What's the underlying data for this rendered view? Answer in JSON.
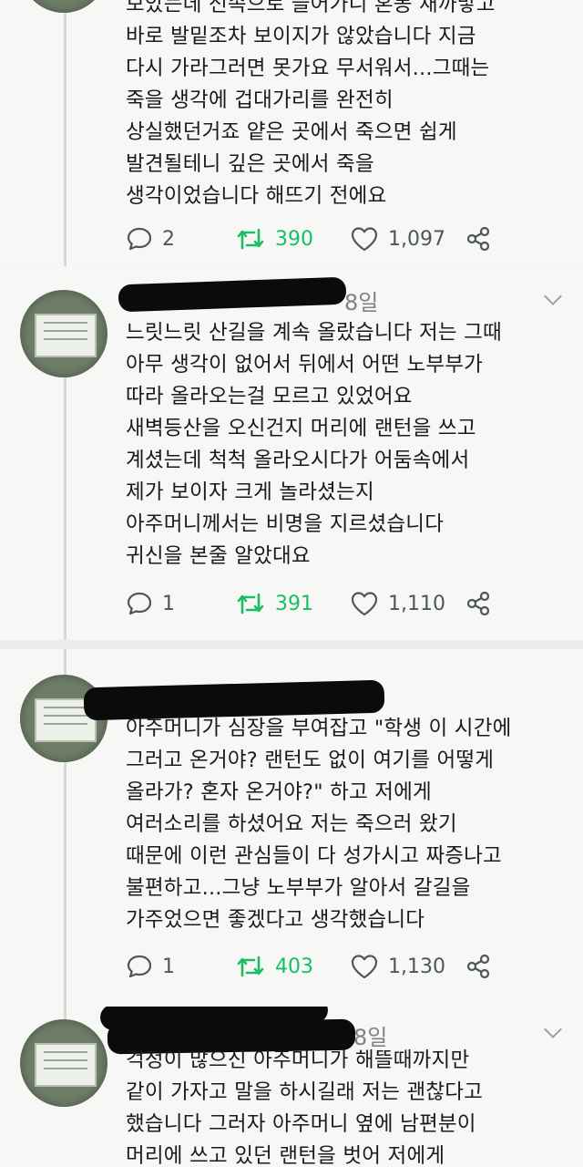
{
  "tweets": [
    {
      "lines": [
        "보았는데 전속으로 들어가니 혼동 새까맣고",
        "바로 발밑조차 보이지가 않았습니다 지금",
        "다시 가라그러면 못가요 무서워서...그때는",
        "죽을 생각에 겁대가리를 완전히",
        "상실했던거죠 얕은 곳에서 죽으면 쉽게",
        "발견될테니 깊은 곳에서 죽을",
        "생각이었습니다 해뜨기 전에요"
      ],
      "replies": "2",
      "retweets": "390",
      "likes": "1,097"
    },
    {
      "date": "8일",
      "lines": [
        "느릿느릿 산길을 계속 올랐습니다 저는 그때",
        "아무 생각이 없어서 뒤에서 어떤 노부부가",
        "따라 올라오는걸 모르고 있었어요",
        "새벽등산을 오신건지 머리에 랜턴을 쓰고",
        "계셨는데 척척 올라오시다가 어둠속에서",
        "제가 보이자 크게 놀라셨는지",
        "아주머니께서는 비명을 지르셨습니다",
        "귀신을 본줄 알았대요"
      ],
      "replies": "1",
      "retweets": "391",
      "likes": "1,110"
    },
    {
      "lines": [
        "아주머니가 심장을 부여잡고 \"학생 이 시간에",
        "그러고 온거야? 랜턴도 없이 여기를 어떻게",
        "올라가? 혼자 온거야?\" 하고 저에게",
        "여러소리를 하셨어요 저는 죽으러 왔기",
        "때문에 이런 관심들이 다 성가시고 짜증나고",
        "불편하고...그냥 노부부가 알아서 갈길을",
        "가주었으면 좋겠다고 생각했습니다"
      ],
      "replies": "1",
      "retweets": "403",
      "likes": "1,130"
    },
    {
      "date": "8일",
      "lines": [
        "걱정이 많으신 아주머니가 해뜰때까지만",
        "같이 가자고 말을 하시길래 저는 괜찮다고",
        "했습니다 그러자 아주머니 옆에 남편분이",
        "머리에 쓰고 있던 랜턴을 벗어 저에게"
      ]
    }
  ],
  "icons": {
    "reply": "reply-bubble-icon",
    "retweet": "retweet-icon",
    "like": "heart-icon",
    "share": "share-icon",
    "more": "chevron-down-icon"
  },
  "colors": {
    "retweet": "#17bf63",
    "icon": "#4d565d",
    "redaction": "#0b0b0b"
  }
}
